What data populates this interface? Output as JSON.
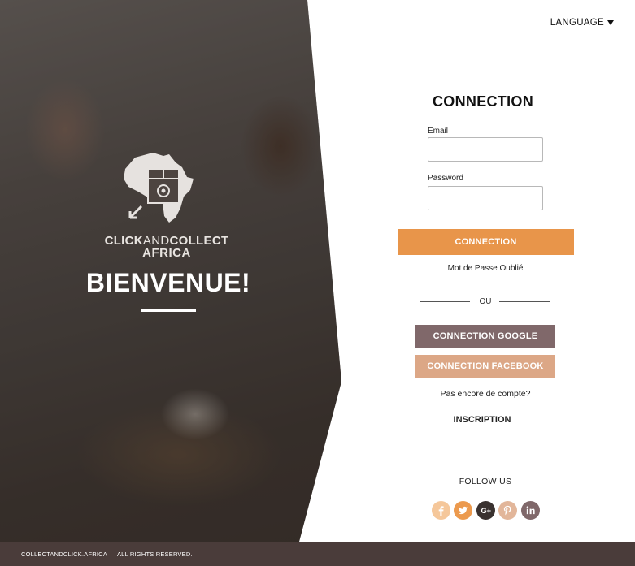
{
  "brand": {
    "name_part1": "CLICK",
    "name_part2": "AND",
    "name_part3": "COLLECT",
    "name_line2": "AFRICA",
    "logo_icon": "africa-package-logo"
  },
  "hero": {
    "welcome": "BIENVENUE!"
  },
  "header": {
    "language_label": "LANGUAGE"
  },
  "login": {
    "title": "CONNECTION",
    "email_label": "Email",
    "email_value": "",
    "password_label": "Password",
    "password_value": "",
    "submit_label": "CONNECTION",
    "forgot_label": "Mot de Passe Oublié",
    "or_label": "OU",
    "google_label": "CONNECTION GOOGLE",
    "facebook_label": "CONNECTION FACEBOOK",
    "no_account_label": "Pas encore de compte?",
    "signup_label": "INSCRIPTION"
  },
  "follow": {
    "label": "FOLLOW US",
    "icons": [
      "facebook-icon",
      "twitter-icon",
      "google-plus-icon",
      "pinterest-icon",
      "linkedin-icon"
    ]
  },
  "footer": {
    "site": "COLLECTANDCLICK.AFRICA",
    "rights": "ALL RIGHTS RESERVED."
  },
  "colors": {
    "accent_orange": "#e8954a",
    "google_button": "#80686a",
    "facebook_button": "#dca786",
    "footer_bg": "#4a3c3a"
  }
}
